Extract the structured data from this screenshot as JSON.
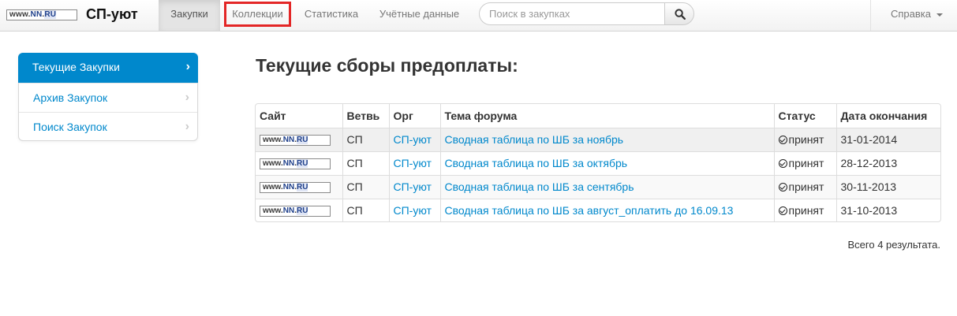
{
  "navbar": {
    "logo": {
      "prefix": "www.",
      "nn": "NN",
      "suffix": ".",
      "ru": "RU"
    },
    "brand": "СП-уют",
    "items": [
      {
        "label": "Закупки",
        "active": true
      },
      {
        "label": "Коллекции",
        "highlighted": true
      },
      {
        "label": "Статистика"
      },
      {
        "label": "Учётные данные"
      }
    ],
    "search": {
      "placeholder": "Поиск в закупках",
      "value": ""
    },
    "help": "Справка",
    "icons": {
      "search": "search-icon",
      "caret": "caret-down-icon"
    }
  },
  "sidebar": {
    "items": [
      {
        "label": "Текущие Закупки",
        "active": true
      },
      {
        "label": "Архив Закупок"
      },
      {
        "label": "Поиск Закупок"
      }
    ],
    "chevron": "›"
  },
  "main": {
    "title": "Текущие сборы предоплаты:",
    "table": {
      "headers": [
        "Сайт",
        "Ветвь",
        "Орг",
        "Тема форума",
        "Статус",
        "Дата окончания"
      ],
      "rows": [
        {
          "branch": "СП",
          "org": "СП-уют",
          "topic": "Сводная таблица по ШБ за ноябрь",
          "status": "принят",
          "date": "31-01-2014"
        },
        {
          "branch": "СП",
          "org": "СП-уют",
          "topic": "Сводная таблица по ШБ за октябрь",
          "status": "принят",
          "date": "28-12-2013"
        },
        {
          "branch": "СП",
          "org": "СП-уют",
          "topic": "Сводная таблица по ШБ за сентябрь",
          "status": "принят",
          "date": "30-11-2013"
        },
        {
          "branch": "СП",
          "org": "СП-уют",
          "topic": "Сводная таблица по ШБ за август_оплатить до 16.09.13",
          "status": "принят",
          "date": "31-10-2013"
        }
      ]
    },
    "results": "Всего 4 результата."
  },
  "colors": {
    "link": "#0088cc",
    "highlight_border": "#e32626",
    "active_bg": "#0088cc"
  }
}
